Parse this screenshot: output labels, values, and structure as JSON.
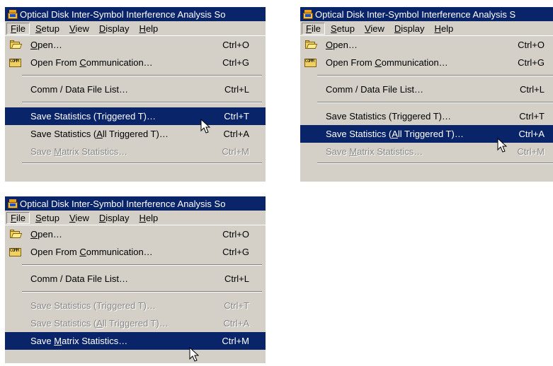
{
  "window_title": "Optical Disk Inter-Symbol Interference Analysis So",
  "window_title_full": "Optical Disk Inter-Symbol Interference Analysis S",
  "menubar": [
    {
      "label": "File",
      "ul": "F"
    },
    {
      "label": "Setup",
      "ul": "S"
    },
    {
      "label": "View",
      "ul": "V"
    },
    {
      "label": "Display",
      "ul": "D"
    },
    {
      "label": "Help",
      "ul": "H"
    }
  ],
  "file_menu": {
    "open": {
      "pre": "",
      "ul": "O",
      "post": "pen…",
      "shortcut": "Ctrl+O",
      "icon": "folder-open-icon"
    },
    "open_comm": {
      "pre": "Open From ",
      "ul": "C",
      "post": "ommunication…",
      "shortcut": "Ctrl+G",
      "icon": "comm-icon",
      "icon_text": "COMM"
    },
    "file_list": {
      "label": "Comm / Data File List…",
      "shortcut": "Ctrl+L"
    },
    "save_triggered": {
      "label": "Save Statistics (Triggered T)…",
      "shortcut": "Ctrl+T"
    },
    "save_all": {
      "pre": "Save Statistics (",
      "ul": "A",
      "post": "ll Triggered T)…",
      "shortcut": "Ctrl+A"
    },
    "save_matrix": {
      "pre": "Save ",
      "ul": "M",
      "post": "atrix Statistics…",
      "shortcut": "Ctrl+M"
    }
  },
  "panels": [
    {
      "highlighted": "save_triggered",
      "disabled": [
        "save_matrix"
      ]
    },
    {
      "highlighted": "save_all",
      "disabled": [
        "save_matrix"
      ]
    },
    {
      "highlighted": "save_matrix",
      "disabled": [
        "save_triggered",
        "save_all"
      ]
    }
  ]
}
